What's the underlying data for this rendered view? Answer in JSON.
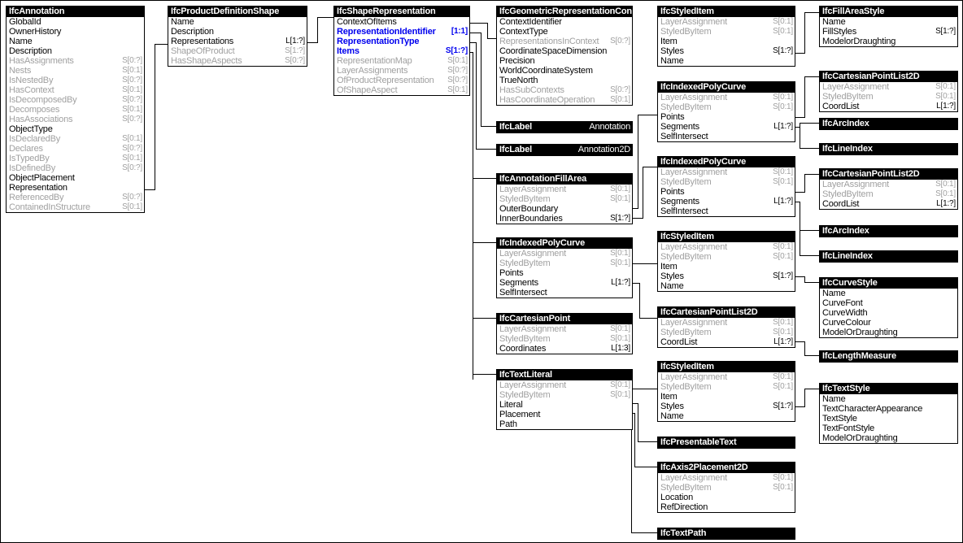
{
  "diagram": {
    "title": "IfcAnnotation entity relationship diagram",
    "colors": {
      "header_bg": "#000000",
      "header_fg": "#ffffff",
      "inverse_attr": "#a0a0a0",
      "highlight_attr": "#0000ee",
      "line": "#000000",
      "background": "#ffffff"
    }
  },
  "boxes": [
    {
      "id": "ifcannotation",
      "title": "IfcAnnotation",
      "rows": [
        {
          "label": "GlobalId",
          "card": "",
          "style": "normal"
        },
        {
          "label": "OwnerHistory",
          "card": "",
          "style": "normal"
        },
        {
          "label": "Name",
          "card": "",
          "style": "normal"
        },
        {
          "label": "Description",
          "card": "",
          "style": "normal"
        },
        {
          "label": "HasAssignments",
          "card": "S[0:?]",
          "style": "inverse"
        },
        {
          "label": "Nests",
          "card": "S[0:1]",
          "style": "inverse"
        },
        {
          "label": "IsNestedBy",
          "card": "S[0:?]",
          "style": "inverse"
        },
        {
          "label": "HasContext",
          "card": "S[0:1]",
          "style": "inverse"
        },
        {
          "label": "IsDecomposedBy",
          "card": "S[0:?]",
          "style": "inverse"
        },
        {
          "label": "Decomposes",
          "card": "S[0:1]",
          "style": "inverse"
        },
        {
          "label": "HasAssociations",
          "card": "S[0:?]",
          "style": "inverse"
        },
        {
          "label": "ObjectType",
          "card": "",
          "style": "normal"
        },
        {
          "label": "IsDeclaredBy",
          "card": "S[0:1]",
          "style": "inverse"
        },
        {
          "label": "Declares",
          "card": "S[0:?]",
          "style": "inverse"
        },
        {
          "label": "IsTypedBy",
          "card": "S[0:1]",
          "style": "inverse"
        },
        {
          "label": "IsDefinedBy",
          "card": "S[0:?]",
          "style": "inverse"
        },
        {
          "label": "ObjectPlacement",
          "card": "",
          "style": "normal"
        },
        {
          "label": "Representation",
          "card": "",
          "style": "normal"
        },
        {
          "label": "ReferencedBy",
          "card": "S[0:?]",
          "style": "inverse"
        },
        {
          "label": "ContainedInStructure",
          "card": "S[0:1]",
          "style": "inverse"
        }
      ]
    },
    {
      "id": "ifcproductdefinitionshape",
      "title": "IfcProductDefinitionShape",
      "rows": [
        {
          "label": "Name",
          "card": "",
          "style": "normal"
        },
        {
          "label": "Description",
          "card": "",
          "style": "normal"
        },
        {
          "label": "Representations",
          "card": "L[1:?]",
          "style": "normal"
        },
        {
          "label": "ShapeOfProduct",
          "card": "S[1:?]",
          "style": "inverse"
        },
        {
          "label": "HasShapeAspects",
          "card": "S[0:?]",
          "style": "inverse"
        }
      ]
    },
    {
      "id": "ifcshaperepresentation",
      "title": "IfcShapeRepresentation",
      "rows": [
        {
          "label": "ContextOfItems",
          "card": "",
          "style": "normal"
        },
        {
          "label": "RepresentationIdentifier",
          "card": "[1:1]",
          "style": "highlight"
        },
        {
          "label": "RepresentationType",
          "card": "",
          "style": "highlight"
        },
        {
          "label": "Items",
          "card": "S[1:?]",
          "style": "highlight"
        },
        {
          "label": "RepresentationMap",
          "card": "S[0:1]",
          "style": "inverse"
        },
        {
          "label": "LayerAssignments",
          "card": "S[0:?]",
          "style": "inverse"
        },
        {
          "label": "OfProductRepresentation",
          "card": "S[0:?]",
          "style": "inverse"
        },
        {
          "label": "OfShapeAspect",
          "card": "S[0:1]",
          "style": "inverse"
        }
      ]
    },
    {
      "id": "ifcgeometricrepresentationcontext",
      "title": "IfcGeometricRepresentationCont",
      "rows": [
        {
          "label": "ContextIdentifier",
          "card": "",
          "style": "normal"
        },
        {
          "label": "ContextType",
          "card": "",
          "style": "normal"
        },
        {
          "label": "RepresentationsInContext",
          "card": "S[0:?]",
          "style": "inverse"
        },
        {
          "label": "CoordinateSpaceDimension",
          "card": "",
          "style": "normal"
        },
        {
          "label": "Precision",
          "card": "",
          "style": "normal"
        },
        {
          "label": "WorldCoordinateSystem",
          "card": "",
          "style": "normal"
        },
        {
          "label": "TrueNorth",
          "card": "",
          "style": "normal"
        },
        {
          "label": "HasSubContexts",
          "card": "S[0:?]",
          "style": "inverse"
        },
        {
          "label": "HasCoordinateOperation",
          "card": "S[0:1]",
          "style": "inverse"
        }
      ]
    },
    {
      "id": "ifclabel-annotation",
      "title": "IfcLabel",
      "header_value": "Annotation",
      "rows": []
    },
    {
      "id": "ifclabel-annotation2d",
      "title": "IfcLabel",
      "header_value": "Annotation2D",
      "rows": []
    },
    {
      "id": "ifcannotationfillarea",
      "title": "IfcAnnotationFillArea",
      "rows": [
        {
          "label": "LayerAssignment",
          "card": "S[0:1]",
          "style": "inverse"
        },
        {
          "label": "StyledByItem",
          "card": "S[0:1]",
          "style": "inverse"
        },
        {
          "label": "OuterBoundary",
          "card": "",
          "style": "normal"
        },
        {
          "label": "InnerBoundaries",
          "card": "S[1:?]",
          "style": "normal"
        }
      ]
    },
    {
      "id": "ifcindexedpolycurve-mid",
      "title": "IfcIndexedPolyCurve",
      "rows": [
        {
          "label": "LayerAssignment",
          "card": "S[0:1]",
          "style": "inverse"
        },
        {
          "label": "StyledByItem",
          "card": "S[0:1]",
          "style": "inverse"
        },
        {
          "label": "Points",
          "card": "",
          "style": "normal"
        },
        {
          "label": "Segments",
          "card": "L[1:?]",
          "style": "normal"
        },
        {
          "label": "SelfIntersect",
          "card": "",
          "style": "normal"
        }
      ]
    },
    {
      "id": "ifccartesianpoint",
      "title": "IfcCartesianPoint",
      "rows": [
        {
          "label": "LayerAssignment",
          "card": "S[0:1]",
          "style": "inverse"
        },
        {
          "label": "StyledByItem",
          "card": "S[0:1]",
          "style": "inverse"
        },
        {
          "label": "Coordinates",
          "card": "L[1:3]",
          "style": "normal"
        }
      ]
    },
    {
      "id": "ifctextliteral",
      "title": "IfcTextLiteral",
      "rows": [
        {
          "label": "LayerAssignment",
          "card": "S[0:1]",
          "style": "inverse"
        },
        {
          "label": "StyledByItem",
          "card": "S[0:1]",
          "style": "inverse"
        },
        {
          "label": "Literal",
          "card": "",
          "style": "normal"
        },
        {
          "label": "Placement",
          "card": "",
          "style": "normal"
        },
        {
          "label": "Path",
          "card": "",
          "style": "normal"
        }
      ]
    },
    {
      "id": "ifcstyleditem-1",
      "title": "IfcStyledItem",
      "rows": [
        {
          "label": "LayerAssignment",
          "card": "S[0:1]",
          "style": "inverse"
        },
        {
          "label": "StyledByItem",
          "card": "S[0:1]",
          "style": "inverse"
        },
        {
          "label": "Item",
          "card": "",
          "style": "normal"
        },
        {
          "label": "Styles",
          "card": "S[1:?]",
          "style": "normal"
        },
        {
          "label": "Name",
          "card": "",
          "style": "normal"
        }
      ]
    },
    {
      "id": "ifcindexedpolycurve-c3a",
      "title": "IfcIndexedPolyCurve",
      "rows": [
        {
          "label": "LayerAssignment",
          "card": "S[0:1]",
          "style": "inverse"
        },
        {
          "label": "StyledByItem",
          "card": "S[0:1]",
          "style": "inverse"
        },
        {
          "label": "Points",
          "card": "",
          "style": "normal"
        },
        {
          "label": "Segments",
          "card": "L[1:?]",
          "style": "normal"
        },
        {
          "label": "SelfIntersect",
          "card": "",
          "style": "normal"
        }
      ]
    },
    {
      "id": "ifcindexedpolycurve-c3b",
      "title": "IfcIndexedPolyCurve",
      "rows": [
        {
          "label": "LayerAssignment",
          "card": "S[0:1]",
          "style": "inverse"
        },
        {
          "label": "StyledByItem",
          "card": "S[0:1]",
          "style": "inverse"
        },
        {
          "label": "Points",
          "card": "",
          "style": "normal"
        },
        {
          "label": "Segments",
          "card": "L[1:?]",
          "style": "normal"
        },
        {
          "label": "SelfIntersect",
          "card": "",
          "style": "normal"
        }
      ]
    },
    {
      "id": "ifcstyleditem-2",
      "title": "IfcStyledItem",
      "rows": [
        {
          "label": "LayerAssignment",
          "card": "S[0:1]",
          "style": "inverse"
        },
        {
          "label": "StyledByItem",
          "card": "S[0:1]",
          "style": "inverse"
        },
        {
          "label": "Item",
          "card": "",
          "style": "normal"
        },
        {
          "label": "Styles",
          "card": "S[1:?]",
          "style": "normal"
        },
        {
          "label": "Name",
          "card": "",
          "style": "normal"
        }
      ]
    },
    {
      "id": "ifccartesianpointlist2d-mid",
      "title": "IfcCartesianPointList2D",
      "rows": [
        {
          "label": "LayerAssignment",
          "card": "S[0:1]",
          "style": "inverse"
        },
        {
          "label": "StyledByItem",
          "card": "S[0:1]",
          "style": "inverse"
        },
        {
          "label": "CoordList",
          "card": "L[1:?]",
          "style": "normal"
        }
      ]
    },
    {
      "id": "ifcstyleditem-3",
      "title": "IfcStyledItem",
      "rows": [
        {
          "label": "LayerAssignment",
          "card": "S[0:1]",
          "style": "inverse"
        },
        {
          "label": "StyledByItem",
          "card": "S[0:1]",
          "style": "inverse"
        },
        {
          "label": "Item",
          "card": "",
          "style": "normal"
        },
        {
          "label": "Styles",
          "card": "S[1:?]",
          "style": "normal"
        },
        {
          "label": "Name",
          "card": "",
          "style": "normal"
        }
      ]
    },
    {
      "id": "ifcpresentabletext",
      "title": "IfcPresentableText",
      "rows": []
    },
    {
      "id": "ifcaxis2placement2d",
      "title": "IfcAxis2Placement2D",
      "rows": [
        {
          "label": "LayerAssignment",
          "card": "S[0:1]",
          "style": "inverse"
        },
        {
          "label": "StyledByItem",
          "card": "S[0:1]",
          "style": "inverse"
        },
        {
          "label": "Location",
          "card": "",
          "style": "normal"
        },
        {
          "label": "RefDirection",
          "card": "",
          "style": "normal"
        }
      ]
    },
    {
      "id": "ifctextpath",
      "title": "IfcTextPath",
      "rows": []
    },
    {
      "id": "ifcfillareastyle",
      "title": "IfcFillAreaStyle",
      "rows": [
        {
          "label": "Name",
          "card": "",
          "style": "normal"
        },
        {
          "label": "FillStyles",
          "card": "S[1:?]",
          "style": "normal"
        },
        {
          "label": "ModelorDraughting",
          "card": "",
          "style": "normal"
        }
      ]
    },
    {
      "id": "ifccartesianpointlist2d-r1",
      "title": "IfcCartesianPointList2D",
      "rows": [
        {
          "label": "LayerAssignment",
          "card": "S[0:1]",
          "style": "inverse"
        },
        {
          "label": "StyledByItem",
          "card": "S[0:1]",
          "style": "inverse"
        },
        {
          "label": "CoordList",
          "card": "L[1:?]",
          "style": "normal"
        }
      ]
    },
    {
      "id": "ifcarcindex-r1",
      "title": "IfcArcIndex",
      "rows": []
    },
    {
      "id": "ifclineindex-r1",
      "title": "IfcLineIndex",
      "rows": []
    },
    {
      "id": "ifccartesianpointlist2d-r2",
      "title": "IfcCartesianPointList2D",
      "rows": [
        {
          "label": "LayerAssignment",
          "card": "S[0:1]",
          "style": "inverse"
        },
        {
          "label": "StyledByItem",
          "card": "S[0:1]",
          "style": "inverse"
        },
        {
          "label": "CoordList",
          "card": "L[1:?]",
          "style": "normal"
        }
      ]
    },
    {
      "id": "ifcarcindex-r2",
      "title": "IfcArcIndex",
      "rows": []
    },
    {
      "id": "ifclineindex-r2",
      "title": "IfcLineIndex",
      "rows": []
    },
    {
      "id": "ifccurvestyle",
      "title": "IfcCurveStyle",
      "rows": [
        {
          "label": "Name",
          "card": "",
          "style": "normal"
        },
        {
          "label": "CurveFont",
          "card": "",
          "style": "normal"
        },
        {
          "label": "CurveWidth",
          "card": "",
          "style": "normal"
        },
        {
          "label": "CurveColour",
          "card": "",
          "style": "normal"
        },
        {
          "label": "ModelOrDraughting",
          "card": "",
          "style": "normal"
        }
      ]
    },
    {
      "id": "ifclengthmeasure",
      "title": "IfcLengthMeasure",
      "rows": []
    },
    {
      "id": "ifctextstyle",
      "title": "IfcTextStyle",
      "rows": [
        {
          "label": "Name",
          "card": "",
          "style": "normal"
        },
        {
          "label": "TextCharacterAppearance",
          "card": "",
          "style": "normal"
        },
        {
          "label": "TextStyle",
          "card": "",
          "style": "normal"
        },
        {
          "label": "TextFontStyle",
          "card": "",
          "style": "normal"
        },
        {
          "label": "ModelOrDraughting",
          "card": "",
          "style": "normal"
        }
      ]
    }
  ]
}
